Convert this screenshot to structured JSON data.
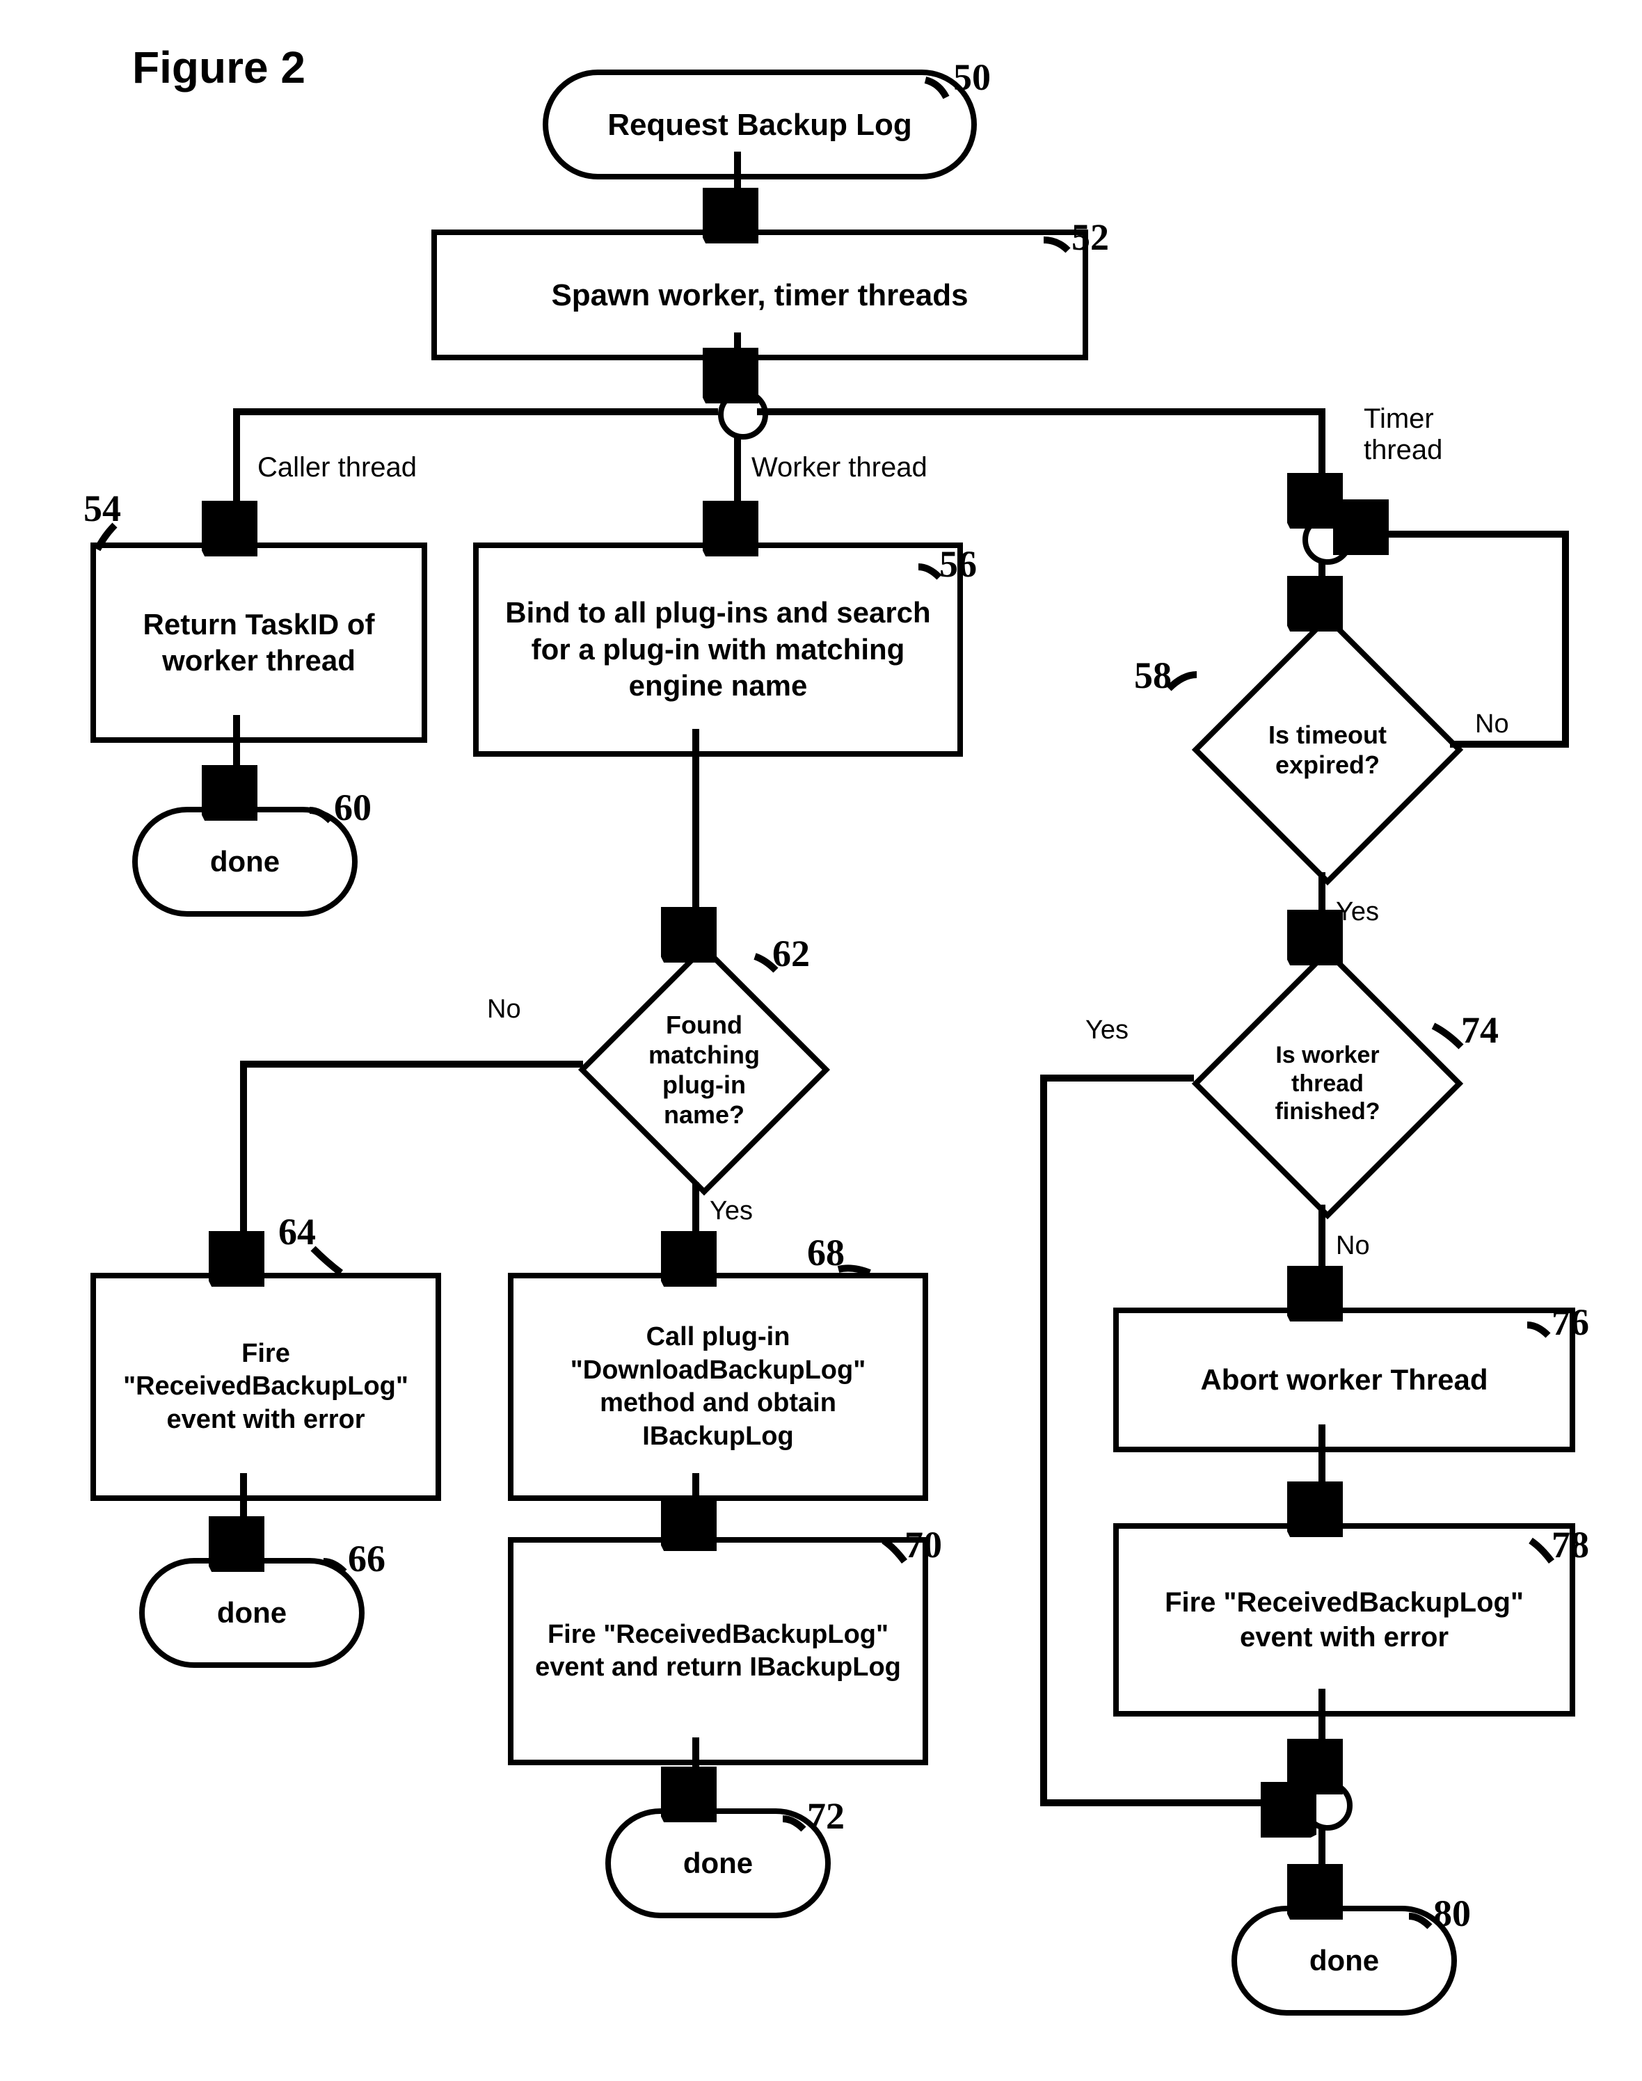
{
  "title": "Figure 2",
  "nodes": {
    "n50": "Request Backup Log",
    "n52": "Spawn worker, timer threads",
    "n54": "Return TaskID of worker thread",
    "n56": "Bind to all plug-ins and search for a plug-in with matching engine name",
    "n58": "Is timeout expired?",
    "n60": "done",
    "n62": "Found matching plug-in name?",
    "n64": "Fire \"ReceivedBackupLog\" event with error",
    "n66": "done",
    "n68": "Call plug-in \"DownloadBackupLog\" method and obtain IBackupLog",
    "n70": "Fire \"ReceivedBackupLog\" event and return IBackupLog",
    "n72": "done",
    "n74": "Is worker thread finished?",
    "n76": "Abort worker Thread",
    "n78": "Fire \"ReceivedBackupLog\" event with error",
    "n80": "done"
  },
  "edgeLabels": {
    "caller": "Caller thread",
    "worker": "Worker thread",
    "timer": "Timer thread",
    "yes": "Yes",
    "no": "No"
  },
  "refs": {
    "r50": "50",
    "r52": "52",
    "r54": "54",
    "r56": "56",
    "r58": "58",
    "r60": "60",
    "r62": "62",
    "r64": "64",
    "r66": "66",
    "r68": "68",
    "r70": "70",
    "r72": "72",
    "r74": "74",
    "r76": "76",
    "r78": "78",
    "r80": "80"
  }
}
